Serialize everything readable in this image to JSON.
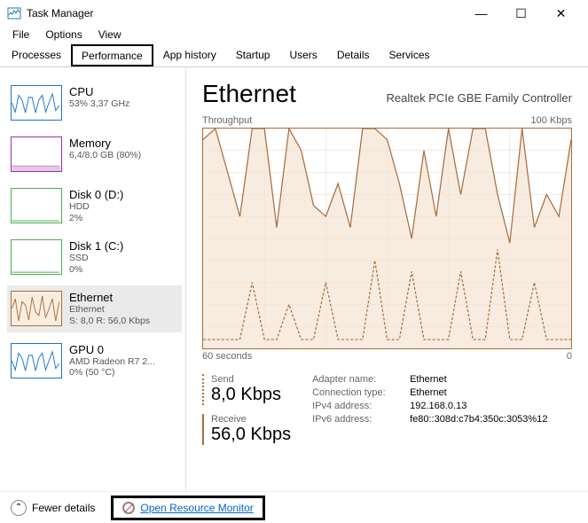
{
  "window": {
    "title": "Task Manager",
    "minimize": "—",
    "maximize": "☐",
    "close": "✕"
  },
  "menu": [
    "File",
    "Options",
    "View"
  ],
  "tabs": [
    "Processes",
    "Performance",
    "App history",
    "Startup",
    "Users",
    "Details",
    "Services"
  ],
  "active_tab": 1,
  "sidebar": [
    {
      "title": "CPU",
      "subtitle": "53%  3,37 GHz",
      "color": "#1a73cc"
    },
    {
      "title": "Memory",
      "subtitle": "6,4/8,0 GB (80%)",
      "color": "#9b2fae"
    },
    {
      "title": "Disk 0 (D:)",
      "subtitle": "HDD\n2%",
      "color": "#4caf50"
    },
    {
      "title": "Disk 1 (C:)",
      "subtitle": "SSD\n0%",
      "color": "#4caf50"
    },
    {
      "title": "Ethernet",
      "subtitle": "Ethernet\nS: 8,0 R: 56,0 Kbps",
      "color": "#a96e3f",
      "selected": true
    },
    {
      "title": "GPU 0",
      "subtitle": "AMD Radeon R7 2...\n0%  (50 °C)",
      "color": "#1a73cc"
    }
  ],
  "main": {
    "title": "Ethernet",
    "subtitle": "Realtek PCIe GBE Family Controller",
    "chart_top_left": "Throughput",
    "chart_top_right": "100 Kbps",
    "chart_bottom_left": "60 seconds",
    "chart_bottom_right": "0",
    "stats": {
      "send_label": "Send",
      "send_value": "8,0 Kbps",
      "recv_label": "Receive",
      "recv_value": "56,0 Kbps"
    },
    "details": [
      {
        "key": "Adapter name:",
        "val": "Ethernet"
      },
      {
        "key": "Connection type:",
        "val": "Ethernet"
      },
      {
        "key": "IPv4 address:",
        "val": "192.168.0.13"
      },
      {
        "key": "IPv6 address:",
        "val": "fe80::308d:c7b4:350c:3053%12"
      }
    ]
  },
  "footer": {
    "fewer": "Fewer details",
    "resmon": "Open Resource Monitor"
  },
  "chart_data": {
    "type": "line",
    "title": "Throughput",
    "xlabel": "60 seconds → 0",
    "ylabel": "Kbps",
    "ylim": [
      0,
      100
    ],
    "x_seconds": [
      60,
      58,
      56,
      54,
      52,
      50,
      48,
      46,
      44,
      42,
      40,
      38,
      36,
      34,
      32,
      30,
      28,
      26,
      24,
      22,
      20,
      18,
      16,
      14,
      12,
      10,
      8,
      6,
      4,
      2,
      0
    ],
    "series": [
      {
        "name": "Receive",
        "color": "#a96e3f",
        "style": "solid",
        "values": [
          95,
          100,
          80,
          60,
          100,
          100,
          55,
          100,
          90,
          65,
          60,
          75,
          55,
          100,
          100,
          95,
          75,
          50,
          90,
          60,
          100,
          70,
          100,
          100,
          70,
          48,
          100,
          55,
          70,
          60,
          95
        ]
      },
      {
        "name": "Send",
        "color": "#a96e3f",
        "style": "dashed",
        "values": [
          4,
          4,
          4,
          4,
          30,
          4,
          4,
          20,
          4,
          4,
          30,
          4,
          4,
          4,
          40,
          4,
          4,
          35,
          4,
          4,
          4,
          35,
          4,
          4,
          45,
          4,
          4,
          30,
          4,
          4,
          4
        ]
      }
    ]
  }
}
